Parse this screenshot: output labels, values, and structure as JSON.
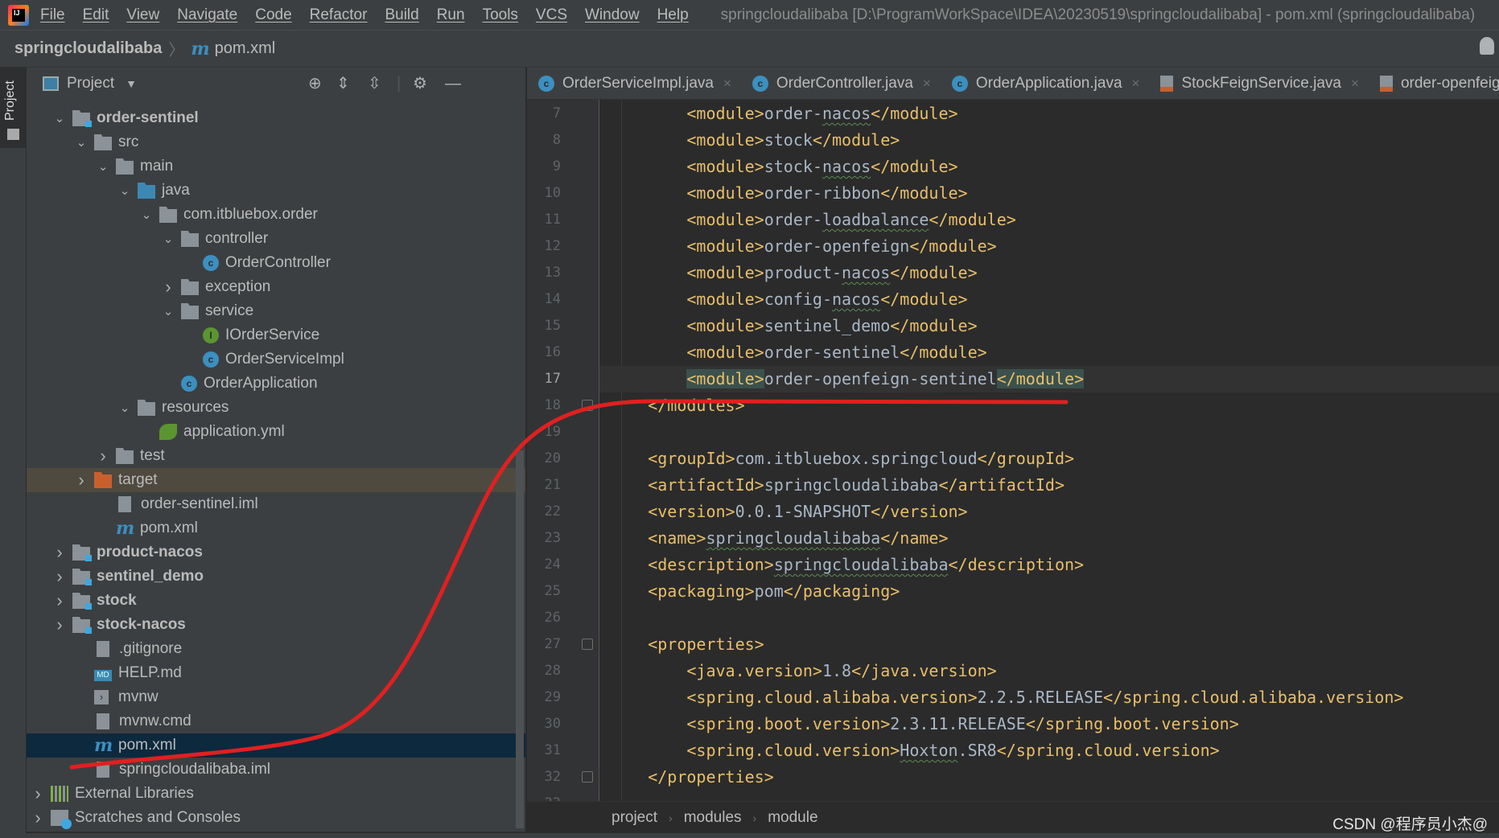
{
  "menubar": {
    "items": [
      "File",
      "Edit",
      "View",
      "Navigate",
      "Code",
      "Refactor",
      "Build",
      "Run",
      "Tools",
      "VCS",
      "Window",
      "Help"
    ],
    "window_title": "springcloudalibaba [D:\\ProgramWorkSpace\\IDEA\\20230519\\springcloudalibaba] - pom.xml (springcloudalibaba)"
  },
  "navbar": {
    "project": "springcloudalibaba",
    "file": "pom.xml"
  },
  "sidebar": {
    "tool_tab": "Project"
  },
  "project_panel": {
    "title": "Project",
    "tree": [
      {
        "label": "order-sentinel",
        "level": 1,
        "icon": "module",
        "chevron": "down",
        "bold": true
      },
      {
        "label": "src",
        "level": 2,
        "icon": "folder",
        "chevron": "down"
      },
      {
        "label": "main",
        "level": 3,
        "icon": "folder",
        "chevron": "down"
      },
      {
        "label": "java",
        "level": 4,
        "icon": "srcfolder",
        "chevron": "down"
      },
      {
        "label": "com.itbluebox.order",
        "level": 5,
        "icon": "pkg",
        "chevron": "down"
      },
      {
        "label": "controller",
        "level": 6,
        "icon": "pkg",
        "chevron": "down"
      },
      {
        "label": "OrderController",
        "level": 7,
        "icon": "cls"
      },
      {
        "label": "exception",
        "level": 6,
        "icon": "pkg",
        "chevron": "right"
      },
      {
        "label": "service",
        "level": 6,
        "icon": "pkg",
        "chevron": "down"
      },
      {
        "label": "IOrderService",
        "level": 7,
        "icon": "iface"
      },
      {
        "label": "OrderServiceImpl",
        "level": 7,
        "icon": "cls"
      },
      {
        "label": "OrderApplication",
        "level": 6,
        "icon": "app"
      },
      {
        "label": "resources",
        "level": 4,
        "icon": "folder",
        "chevron": "down"
      },
      {
        "label": "application.yml",
        "level": 5,
        "icon": "yml"
      },
      {
        "label": "test",
        "level": 3,
        "icon": "folder",
        "chevron": "right"
      },
      {
        "label": "target",
        "level": 2,
        "icon": "orange",
        "chevron": "right",
        "state": "excluded"
      },
      {
        "label": "order-sentinel.iml",
        "level": 3,
        "icon": "file"
      },
      {
        "label": "pom.xml",
        "level": 3,
        "icon": "pom"
      },
      {
        "label": "product-nacos",
        "level": 1,
        "icon": "module",
        "chevron": "right",
        "bold": true
      },
      {
        "label": "sentinel_demo",
        "level": 1,
        "icon": "module",
        "chevron": "right",
        "bold": true
      },
      {
        "label": "stock",
        "level": 1,
        "icon": "module",
        "chevron": "right",
        "bold": true
      },
      {
        "label": "stock-nacos",
        "level": 1,
        "icon": "module",
        "chevron": "right",
        "bold": true
      },
      {
        "label": ".gitignore",
        "level": 2,
        "icon": "file"
      },
      {
        "label": "HELP.md",
        "level": 2,
        "icon": "md"
      },
      {
        "label": "mvnw",
        "level": 2,
        "icon": "sh"
      },
      {
        "label": "mvnw.cmd",
        "level": 2,
        "icon": "file"
      },
      {
        "label": "pom.xml",
        "level": 2,
        "icon": "pom",
        "selected": true
      },
      {
        "label": "springcloudalibaba.iml",
        "level": 2,
        "icon": "file"
      },
      {
        "label": "External Libraries",
        "level": 0,
        "icon": "lib",
        "chevron": "right"
      },
      {
        "label": "Scratches and Consoles",
        "level": 0,
        "icon": "scratch",
        "chevron": "right"
      }
    ]
  },
  "editor": {
    "tabs": [
      {
        "label": "OrderServiceImpl.java",
        "icon": "class-icon"
      },
      {
        "label": "OrderController.java",
        "icon": "class-icon"
      },
      {
        "label": "OrderApplication.java",
        "icon": "spring-app-icon"
      },
      {
        "label": "StockFeignService.java",
        "icon": "java-file-icon"
      },
      {
        "label": "order-openfeign",
        "icon": "xml-file-icon"
      }
    ],
    "current_line": 17,
    "lines": [
      {
        "n": 7,
        "indent": 2,
        "tag": "module",
        "text": "order-nacos",
        "wavy": "nacos"
      },
      {
        "n": 8,
        "indent": 2,
        "tag": "module",
        "text": "stock"
      },
      {
        "n": 9,
        "indent": 2,
        "tag": "module",
        "text": "stock-nacos",
        "wavy": "nacos"
      },
      {
        "n": 10,
        "indent": 2,
        "tag": "module",
        "text": "order-ribbon"
      },
      {
        "n": 11,
        "indent": 2,
        "tag": "module",
        "text": "order-loadbalance",
        "wavy": "loadbalance"
      },
      {
        "n": 12,
        "indent": 2,
        "tag": "module",
        "text": "order-openfeign"
      },
      {
        "n": 13,
        "indent": 2,
        "tag": "module",
        "text": "product-nacos",
        "wavy": "nacos"
      },
      {
        "n": 14,
        "indent": 2,
        "tag": "module",
        "text": "config-nacos",
        "wavy": "nacos"
      },
      {
        "n": 15,
        "indent": 2,
        "tag": "module",
        "text": "sentinel_demo"
      },
      {
        "n": 16,
        "indent": 2,
        "tag": "module",
        "text": "order-sentinel"
      },
      {
        "n": 17,
        "indent": 2,
        "tag": "module",
        "text": "order-openfeign-sentinel",
        "highlight": true
      },
      {
        "n": 18,
        "indent": 1,
        "raw": "</modules>",
        "fold": true
      },
      {
        "n": 19,
        "indent": 0,
        "raw": ""
      },
      {
        "n": 20,
        "indent": 1,
        "tag": "groupId",
        "text": "com.itbluebox.springcloud"
      },
      {
        "n": 21,
        "indent": 1,
        "tag": "artifactId",
        "text": "springcloudalibaba"
      },
      {
        "n": 22,
        "indent": 1,
        "tag": "version",
        "text": "0.0.1-SNAPSHOT"
      },
      {
        "n": 23,
        "indent": 1,
        "tag": "name",
        "text": "springcloudalibaba",
        "wavy": "springcloudalibaba"
      },
      {
        "n": 24,
        "indent": 1,
        "tag": "description",
        "text": "springcloudalibaba",
        "wavy": "springcloudalibaba"
      },
      {
        "n": 25,
        "indent": 1,
        "tag": "packaging",
        "text": "pom"
      },
      {
        "n": 26,
        "indent": 0,
        "raw": ""
      },
      {
        "n": 27,
        "indent": 1,
        "raw": "<properties>",
        "fold": true
      },
      {
        "n": 28,
        "indent": 2,
        "tag": "java.version",
        "text": "1.8"
      },
      {
        "n": 29,
        "indent": 2,
        "tag": "spring.cloud.alibaba.version",
        "text": "2.2.5.RELEASE"
      },
      {
        "n": 30,
        "indent": 2,
        "tag": "spring.boot.version",
        "text": "2.3.11.RELEASE"
      },
      {
        "n": 31,
        "indent": 2,
        "tag": "spring.cloud.version",
        "text": "Hoxton.SR8",
        "wavy": "Hoxton"
      },
      {
        "n": 32,
        "indent": 1,
        "raw": "</properties>",
        "fold": true
      },
      {
        "n": 33,
        "indent": 0,
        "raw": ""
      }
    ],
    "breadcrumb": [
      "project",
      "modules",
      "module"
    ]
  },
  "watermark": "CSDN @程序员小杰@",
  "annotation": {
    "color": "#e02020"
  },
  "colors": {
    "tag": "#e8bf6a",
    "text": "#a9b7c6",
    "selection": "#0d293e"
  }
}
